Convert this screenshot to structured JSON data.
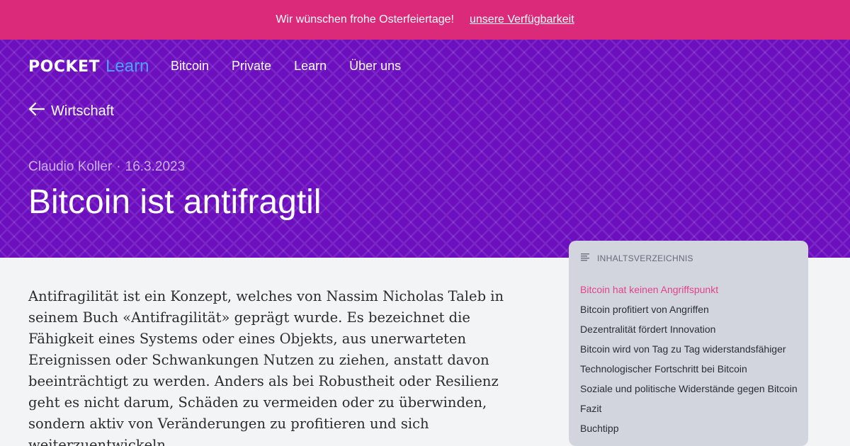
{
  "banner": {
    "message": "Wir wünschen frohe Osterfeiertage!",
    "link": "unsere Verfügbarkeit"
  },
  "header": {
    "logo_main": "POCKET",
    "logo_sub": "Learn",
    "nav": [
      "Bitcoin",
      "Private",
      "Learn",
      "Über uns"
    ]
  },
  "breadcrumb": {
    "back_label": "Wirtschaft"
  },
  "article": {
    "author": "Claudio Koller",
    "separator": "·",
    "date": "16.3.2023",
    "title": "Bitcoin ist antifragtil",
    "body": "Antifragilität ist ein Konzept, welches von Nassim Nicholas Taleb in seinem Buch «Antifragilität» geprägt wurde. Es bezeichnet die Fähigkeit eines Systems oder eines Objekts, aus unerwarteten Ereignissen oder Schwankungen Nutzen zu ziehen, anstatt davon beeinträchtigt zu werden. Anders als bei Robustheit oder Resilienz geht es nicht darum, Schäden zu vermeiden oder zu überwinden, sondern aktiv von Veränderungen zu profitieren und sich weiterzuentwickeln."
  },
  "toc": {
    "heading": "INHALTSVERZEICHNIS",
    "items": [
      "Bitcoin hat keinen Angriffspunkt",
      "Bitcoin profitiert von Angriffen",
      "Dezentralität fördert Innovation",
      "Bitcoin wird von Tag zu Tag widerstandsfähiger",
      "Technologischer Fortschritt bei Bitcoin",
      "Soziale und politische Widerstände gegen Bitcoin",
      "Fazit",
      "Buchtipp"
    ],
    "active_index": 0
  },
  "colors": {
    "banner": "#db2a7a",
    "hero": "#6c0fbe",
    "logo_accent": "#4aa3ff",
    "toc_active": "#e0438c"
  }
}
